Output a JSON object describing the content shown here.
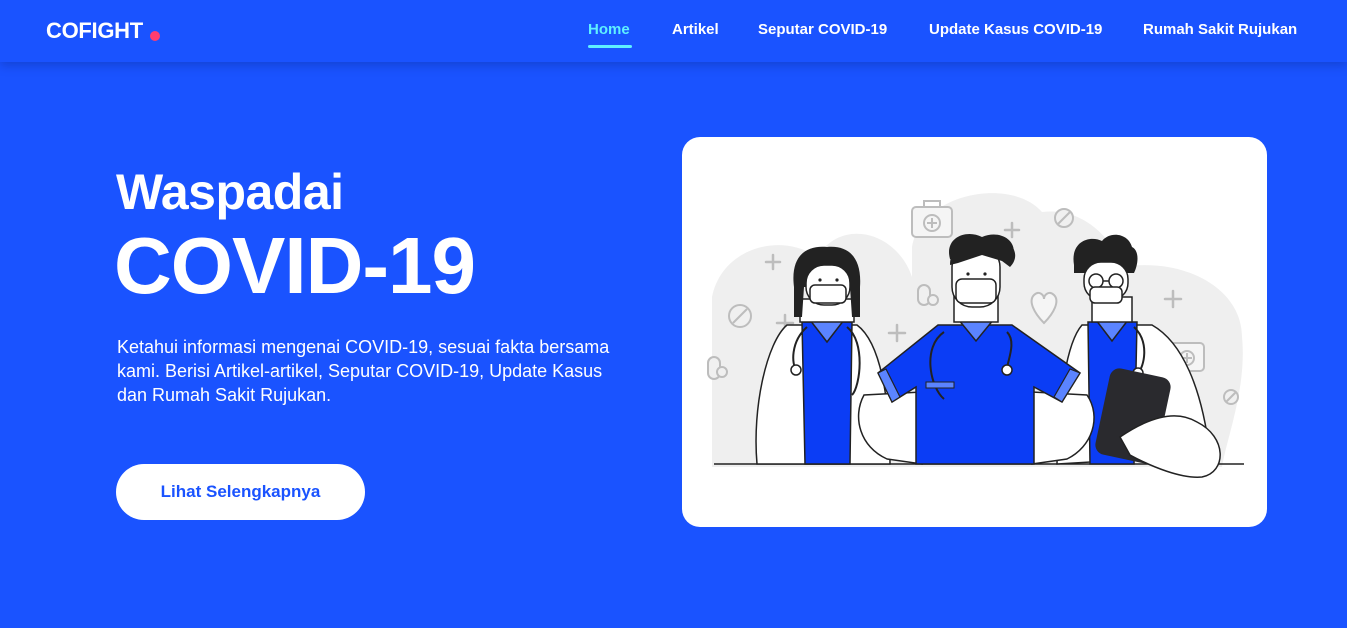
{
  "navbar": {
    "brand": "COFIGHT",
    "links": [
      {
        "label": "Home",
        "active": true
      },
      {
        "label": "Artikel",
        "active": false
      },
      {
        "label": "Seputar COVID-19",
        "active": false
      },
      {
        "label": "Update Kasus COVID-19",
        "active": false
      },
      {
        "label": "Rumah Sakit Rujukan",
        "active": false
      }
    ]
  },
  "hero": {
    "title_line_1": "Waspadai",
    "title_line_2": "COVID-19",
    "description": "Ketahui informasi mengenai COVID-19, sesuai fakta bersama kami. Berisi Artikel-artikel, Seputar COVID-19, Update Kasus dan Rumah Sakit Rujukan.",
    "cta_label": "Lihat Selengkapnya"
  },
  "illustration": {
    "icons": [
      "medical-kit-icon",
      "plus-icon",
      "pill-icon",
      "capsule-icon",
      "heart-icon"
    ]
  },
  "colors": {
    "background": "#1a53ff",
    "active_link": "#5ff0ff",
    "brand_dot": "#ff3d6e",
    "scrub_blue": "#0b3df5",
    "scrub_light": "#5b84ff"
  }
}
